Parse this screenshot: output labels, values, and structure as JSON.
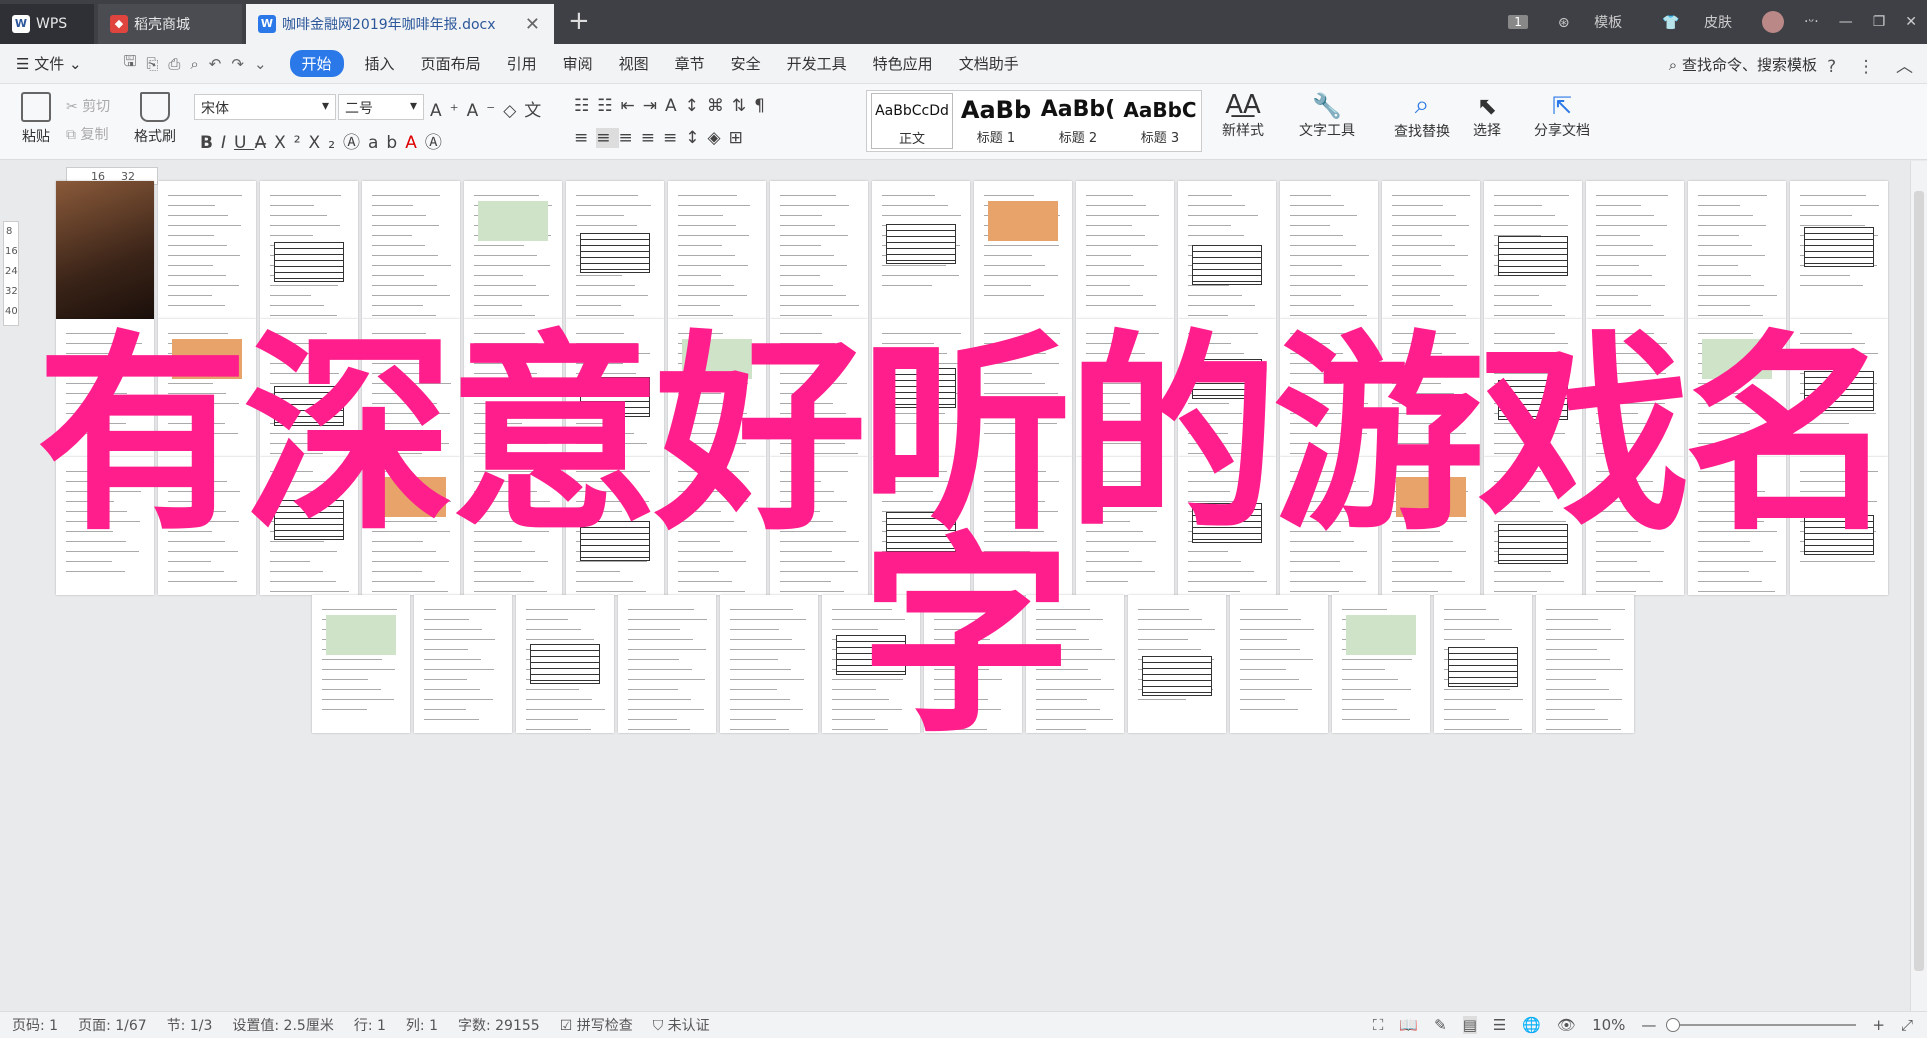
{
  "tabs": {
    "wps": "WPS",
    "shop": "稻壳商城",
    "doc": "咖啡金融网2019年咖啡年报.docx"
  },
  "titlebar": {
    "count_badge": "1",
    "template": "模板",
    "skin": "皮肤"
  },
  "menubar": {
    "file": "文件",
    "items": [
      "开始",
      "插入",
      "页面布局",
      "引用",
      "审阅",
      "视图",
      "章节",
      "安全",
      "开发工具",
      "特色应用",
      "文档助手"
    ],
    "search": "查找命令、搜索模板"
  },
  "ribbon": {
    "paste": "粘贴",
    "cut": "剪切",
    "copy": "复制",
    "format_painter": "格式刷",
    "font_name": "宋体",
    "font_size": "二号",
    "styles": [
      {
        "preview": "AaBbCcDd",
        "name": "正文"
      },
      {
        "preview": "AaBb",
        "name": "标题 1"
      },
      {
        "preview": "AaBb(",
        "name": "标题 2"
      },
      {
        "preview": "AaBbC",
        "name": "标题 3"
      }
    ],
    "new_style": "新样式",
    "text_tools": "文字工具",
    "find_replace": "查找替换",
    "select": "选择",
    "share": "分享文档"
  },
  "ruler": {
    "h_marks": [
      "16",
      "32"
    ],
    "v_marks": [
      "8",
      "16",
      "24",
      "32",
      "40"
    ]
  },
  "overlay": {
    "line1": "有深意好听的游戏名",
    "line2": "字"
  },
  "statusbar": {
    "page_code": "页码: 1",
    "page": "页面: 1/67",
    "section": "节: 1/3",
    "setting": "设置值: 2.5厘米",
    "row": "行: 1",
    "col": "列: 1",
    "words": "字数: 29155",
    "spell": "拼写检查",
    "cert": "未认证",
    "zoom": "10%"
  },
  "colors": {
    "accent": "#2b79e8",
    "overlay": "#ff1e8c",
    "titlebar": "#3e4046"
  }
}
